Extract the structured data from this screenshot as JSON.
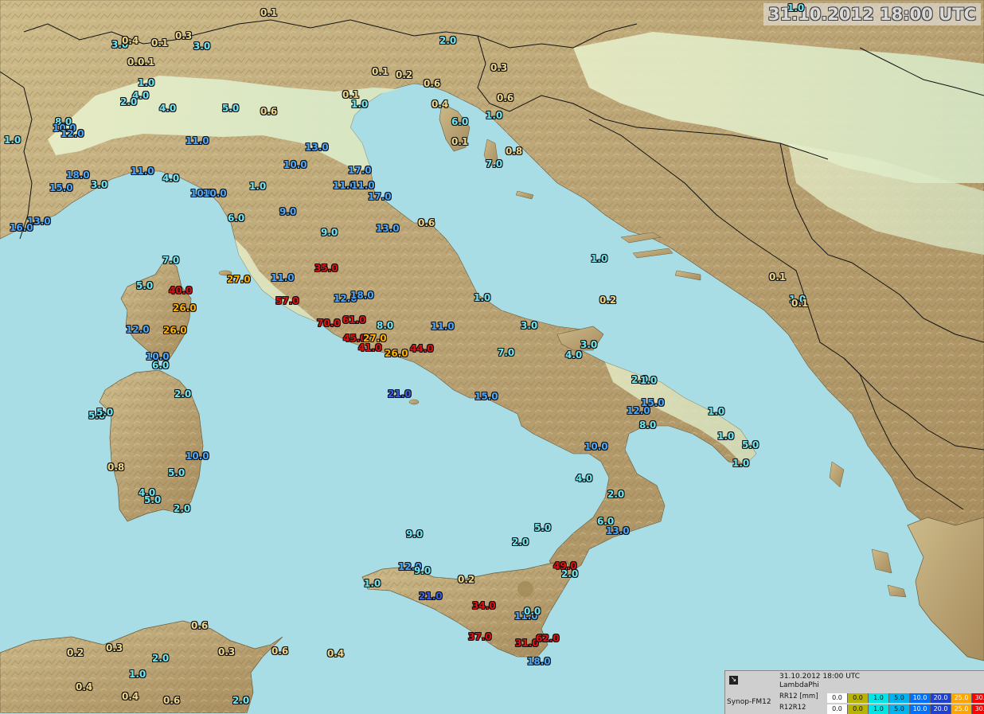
{
  "title": "31.10.2012 18:00 UTC",
  "legend": {
    "source": "Synop-FM12",
    "datetime": "31.10.2012 18:00 UTC",
    "model": "LambdaPhi",
    "rows": [
      {
        "label": "RR12 [mm]",
        "values": [
          "0.0",
          "0.0",
          "1.0",
          "5.0",
          "10.0",
          "20.0",
          "25.0",
          "30.0"
        ]
      },
      {
        "label": "R12R12",
        "values": [
          "0.0",
          "0.0",
          "1.0",
          "5.0",
          "10.0",
          "20.0",
          "25.0",
          "30.0"
        ]
      }
    ],
    "colors": [
      "#ffffff",
      "#b8b400",
      "#00e6e6",
      "#00b4f0",
      "#0070ff",
      "#2040d0",
      "#ffa500",
      "#ff0000"
    ]
  },
  "colors": {
    "sea": "#a8dde6",
    "land_low": "#dde9c4",
    "land_high": "#b39a6a",
    "v0": "#f0d88a",
    "v1": "#6fe8f5",
    "v10": "#4aa8ff",
    "v20": "#3a5fe8",
    "v25": "#ffb000",
    "v30": "#e01010"
  },
  "observations": [
    "0.1",
    "3.0",
    "0.4",
    "0.1",
    "0.3",
    "3.0",
    "0.1",
    "0.1",
    "1.0",
    "4.0",
    "2.0",
    "4.0",
    "5.0",
    "0.6",
    "8.0",
    "10.0",
    "12.0",
    "1.0",
    "11.0",
    "18.0",
    "15.0",
    "3.0",
    "11.0",
    "4.0",
    "10.0",
    "10.0",
    "1.0",
    "13.0",
    "16.0",
    "6.0",
    "13.0",
    "10.0",
    "17.0",
    "11.0",
    "11.0",
    "17.0",
    "9.0",
    "9.0",
    "13.0",
    "0.6",
    "7.0",
    "27.0",
    "35.0",
    "11.0",
    "5.0",
    "40.0",
    "26.0",
    "57.0",
    "12.0",
    "18.0",
    "12.0",
    "26.0",
    "70.0",
    "61.0",
    "8.0",
    "11.0",
    "45.0",
    "27.0",
    "41.0",
    "26.0",
    "44.0",
    "10.0",
    "6.0",
    "21.0",
    "2.0",
    "5.0",
    "5.0",
    "1.0",
    "15.0",
    "3.0",
    "3.0",
    "4.0",
    "7.0",
    "2.0",
    "1.0",
    "12.0",
    "8.0",
    "15.0",
    "1.0",
    "1.0",
    "5.0",
    "1.0",
    "10.0",
    "0.8",
    "10.0",
    "5.0",
    "4.0",
    "5.0",
    "2.0",
    "4.0",
    "2.0",
    "6.0",
    "13.0",
    "9.0",
    "5.0",
    "2.0",
    "12.0",
    "9.0",
    "0.2",
    "49.0",
    "2.0",
    "1.0",
    "21.0",
    "34.0",
    "11.0",
    "0.0",
    "37.0",
    "31.0",
    "62.0",
    "18.0",
    "0.6",
    "0.2",
    "0.3",
    "0.6",
    "2.0",
    "0.3",
    "0.4",
    "1.0",
    "0.4",
    "0.4",
    "0.6",
    "2.0",
    "1.0",
    "2.0",
    "0.3",
    "0.1",
    "0.2",
    "0.6",
    "0.4",
    "0.6",
    "0.1",
    "1.0",
    "6.0",
    "1.0",
    "0.1",
    "7.0",
    "0.8",
    "1.0",
    "0.2",
    "0.1",
    "1.0",
    "0.1",
    "0.6",
    "0.4",
    "1.0",
    "0.3",
    "0.1"
  ],
  "observation_levels": [
    0,
    1,
    0,
    0,
    0,
    1,
    0,
    0,
    1,
    1,
    1,
    1,
    1,
    0,
    1,
    2,
    2,
    1,
    2,
    2,
    2,
    1,
    2,
    1,
    2,
    2,
    1,
    2,
    2,
    1,
    2,
    2,
    2,
    2,
    2,
    2,
    2,
    1,
    2,
    0,
    1,
    4,
    5,
    2,
    1,
    5,
    4,
    5,
    2,
    2,
    2,
    4,
    5,
    5,
    1,
    2,
    5,
    4,
    5,
    4,
    5,
    2,
    1,
    3,
    1,
    1,
    1,
    1,
    2,
    1,
    1,
    1,
    1,
    1,
    1,
    2,
    1,
    2,
    1,
    1,
    1,
    1,
    2,
    0,
    2,
    1,
    1,
    1,
    1,
    1,
    1,
    1,
    2,
    1,
    1,
    1,
    2,
    1,
    0,
    5,
    1,
    1,
    3,
    5,
    2,
    1,
    5,
    5,
    5,
    2,
    0,
    0,
    0,
    0,
    1,
    0,
    0,
    1,
    0,
    0,
    0,
    1,
    1,
    1,
    0,
    0,
    0,
    0,
    0,
    0,
    0,
    1,
    1,
    1,
    0,
    1,
    0,
    1,
    0,
    0,
    1,
    0,
    0,
    0,
    1,
    0,
    0
  ]
}
